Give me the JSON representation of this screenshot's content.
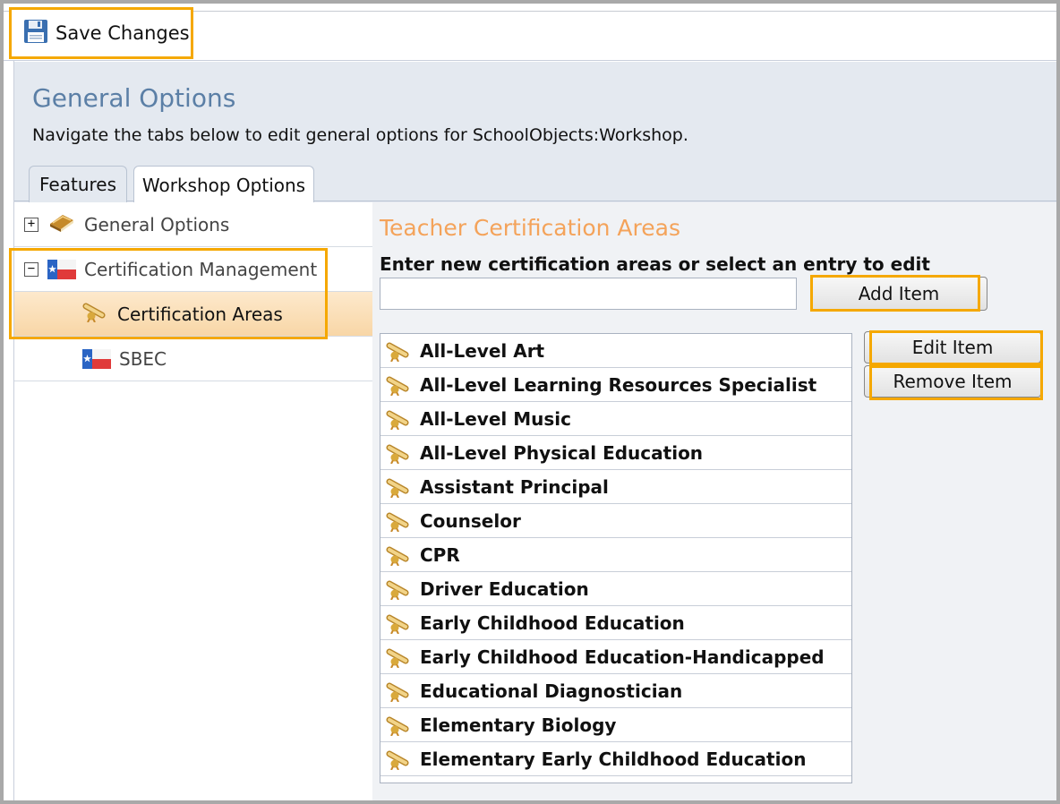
{
  "toolbar": {
    "save_label": "Save Changes"
  },
  "header": {
    "title": "General Options",
    "description": "Navigate the tabs below to edit general options for SchoolObjects:Workshop."
  },
  "tabs": [
    {
      "label": "Features"
    },
    {
      "label": "Workshop Options"
    }
  ],
  "tree": {
    "general_options": {
      "label": "General Options",
      "expander": "+"
    },
    "certification_management": {
      "label": "Certification Management",
      "expander": "−"
    },
    "certification_areas": {
      "label": "Certification Areas"
    },
    "sbec": {
      "label": "SBEC"
    }
  },
  "content": {
    "section_title": "Teacher Certification Areas",
    "instruction": "Enter new certification areas or select an entry to edit",
    "input_value": "",
    "add_label": "Add Item",
    "edit_label": "Edit Item",
    "remove_label": "Remove Item",
    "items": [
      "All-Level Art",
      "All-Level Learning Resources Specialist",
      "All-Level Music",
      "All-Level Physical Education",
      "Assistant Principal",
      "Counselor",
      "CPR",
      "Driver Education",
      "Early Childhood Education",
      "Early Childhood Education-Handicapped",
      "Educational Diagnostician",
      "Elementary Biology",
      "Elementary Early Childhood Education"
    ]
  },
  "colors": {
    "highlight": "#f5a800",
    "title_blue": "#5b7fa6",
    "section_orange": "#f4a35a",
    "selected_row": "#f8d6a6"
  }
}
